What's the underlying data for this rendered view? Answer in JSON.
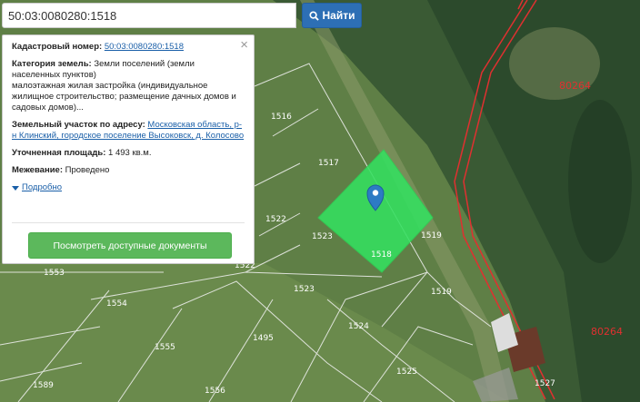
{
  "search": {
    "value": "50:03:0080280:1518",
    "button_label": "Найти"
  },
  "info": {
    "cadastral_label": "Кадастровый номер:",
    "cadastral_value": "50:03:0080280:1518",
    "category_label": "Категория земель:",
    "category_value": "Земли поселений (земли населенных пунктов)",
    "usage_text": "малоэтажная жилая застройка (индивидуальное жилищное строительство; размещение дачных домов и садовых домов)...",
    "address_label": "Земельный участок по адресу:",
    "address_value": "Московская область, р-н Клинский, городское поселение Высоковск, д. Колосово",
    "area_label": "Уточненная площадь:",
    "area_value": "1 493 кв.м.",
    "survey_label": "Межевание:",
    "survey_value": "Проведено",
    "more_link": "Подробно",
    "docs_button": "Посмотреть доступные документы"
  },
  "map": {
    "parcel_labels": [
      "1516",
      "1517",
      "1522",
      "1523",
      "1519",
      "1518",
      "1522",
      "1553",
      "1554",
      "1523",
      "1519",
      "1524",
      "1495",
      "1555",
      "1525",
      "1589",
      "1556",
      "1527"
    ],
    "district_labels": [
      "80264",
      "80264"
    ]
  },
  "colors": {
    "selected_parcel": "#34e060",
    "search_button": "#2d6fb5",
    "docs_button": "#5cb85c",
    "link": "#1a5fa8",
    "boundary_red": "#e03030"
  },
  "icons": {
    "search": "magnifier-icon",
    "close": "close-icon",
    "marker": "map-marker-icon",
    "expand": "triangle-down-icon"
  }
}
